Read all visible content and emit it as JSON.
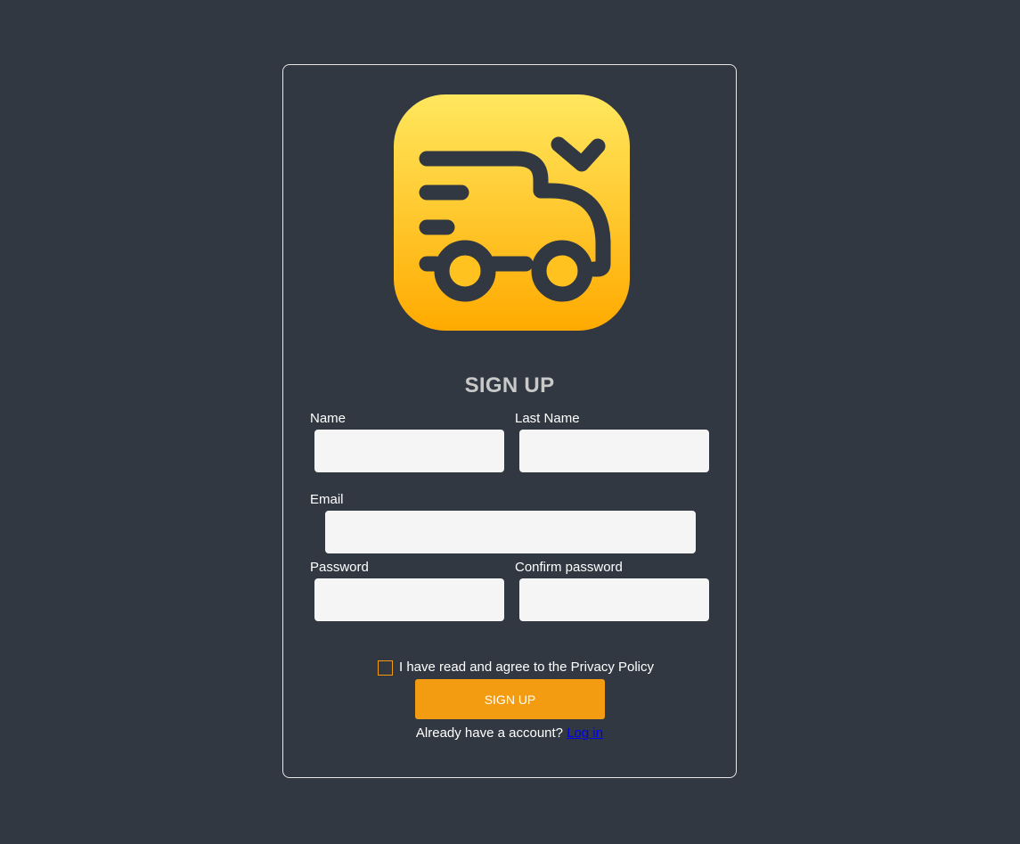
{
  "form": {
    "title": "SIGN UP",
    "name_label": "Name",
    "last_name_label": "Last Name",
    "email_label": "Email",
    "password_label": "Password",
    "confirm_password_label": "Confirm password",
    "name_value": "",
    "last_name_value": "",
    "email_value": "",
    "password_value": "",
    "confirm_password_value": "",
    "agree_text": "I have read and agree to the Privacy Policy",
    "agree_checked": false,
    "submit_label": "SIGN UP",
    "login_prompt": "Already have a account?",
    "login_link": "Log in"
  },
  "logo": {
    "icon": "delivery-truck-icon"
  },
  "colors": {
    "background": "#313842",
    "accent": "#f39c12",
    "logo_gradient_top": "#ffe55e",
    "logo_gradient_bottom": "#ffab00",
    "logo_stroke": "#313842",
    "title": "#c9c9c9",
    "input_bg": "#f5f5f5"
  }
}
